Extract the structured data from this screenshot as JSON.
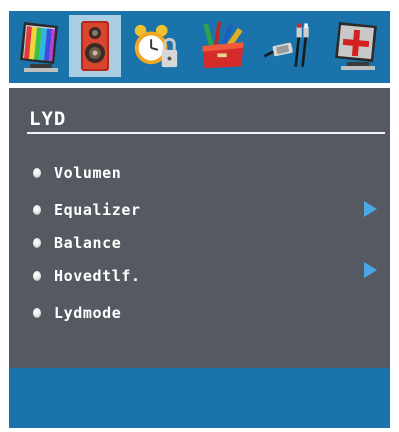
{
  "top_bar": {
    "icons": [
      {
        "name": "picture-tv-icon",
        "selected": false
      },
      {
        "name": "sound-speaker-icon",
        "selected": true
      },
      {
        "name": "timer-alarm-clock-icon",
        "selected": false
      },
      {
        "name": "settings-toolbox-icon",
        "selected": false
      },
      {
        "name": "source-cable-icon",
        "selected": false
      },
      {
        "name": "install-tv-icon",
        "selected": false
      }
    ]
  },
  "menu": {
    "title": "LYD",
    "items": [
      {
        "label": "Volumen",
        "has_submenu": false
      },
      {
        "label": "Equalizer",
        "has_submenu": true
      },
      {
        "label": "Balance",
        "has_submenu": false
      },
      {
        "label": "Hovedtlf.",
        "has_submenu": true
      },
      {
        "label": "Lydmode",
        "has_submenu": false
      }
    ]
  },
  "colors": {
    "accent_blue": "#1b73ab",
    "selected_tab": "#a9cde3",
    "panel": "#555a62",
    "arrow": "#4aa8e6"
  }
}
